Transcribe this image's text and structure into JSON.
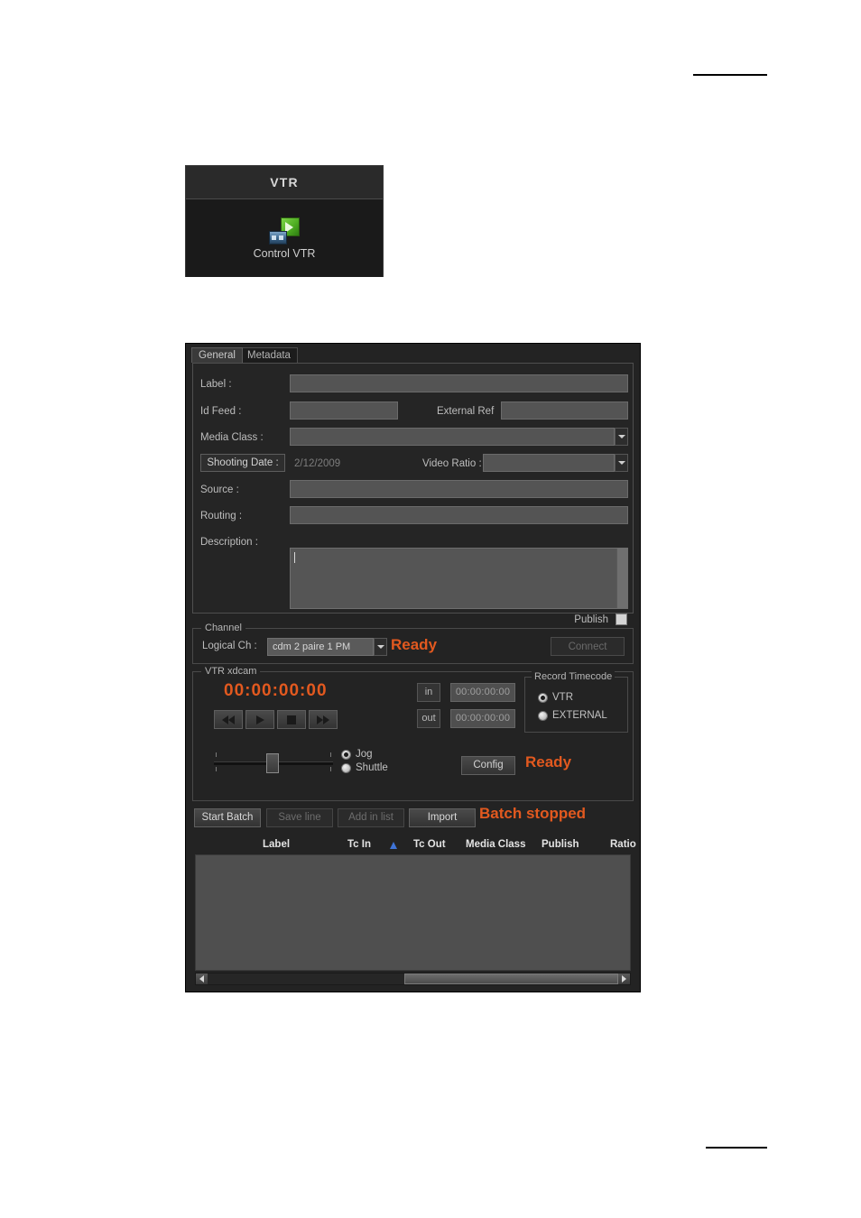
{
  "launcher": {
    "title": "VTR",
    "icon": "control-vtr-icon",
    "label": "Control VTR"
  },
  "dialog": {
    "tabs": [
      {
        "label": "General",
        "active": true
      },
      {
        "label": "Metadata",
        "active": false
      }
    ],
    "general": {
      "fields": [
        {
          "label": "Label :",
          "value": ""
        },
        {
          "label": "Id Feed :",
          "value": ""
        },
        {
          "label": "External Ref",
          "value": ""
        },
        {
          "label": "Media Class :",
          "value": ""
        },
        {
          "label": "Shooting Date :",
          "value": "2/12/2009"
        },
        {
          "label": "Video Ratio :",
          "value": ""
        },
        {
          "label": "Source :",
          "value": ""
        },
        {
          "label": "Routing :",
          "value": ""
        },
        {
          "label": "Description :",
          "value": ""
        }
      ],
      "publish": {
        "label": "Publish",
        "checked": false
      }
    },
    "channel": {
      "group_title": "Channel",
      "logical_label": "Logical Ch :",
      "logical_value": "cdm 2 paire 1 PM",
      "status": "Ready",
      "connect_label": "Connect",
      "connect_enabled": false
    },
    "vtr": {
      "group_title": "VTR xdcam",
      "timecode": "00:00:00:00",
      "transport": [
        {
          "name": "rewind-button",
          "glyph": "double-left"
        },
        {
          "name": "play-button",
          "glyph": "triangle-right"
        },
        {
          "name": "stop-button",
          "glyph": "square"
        },
        {
          "name": "forward-button",
          "glyph": "double-right"
        }
      ],
      "mode": [
        {
          "label": "Jog",
          "selected": true
        },
        {
          "label": "Shuttle",
          "selected": false
        }
      ],
      "in_label": "in",
      "in_value": "00:00:00:00",
      "out_label": "out",
      "out_value": "00:00:00:00",
      "record_timecode": {
        "group_title": "Record Timecode",
        "options": [
          {
            "label": "VTR",
            "selected": true
          },
          {
            "label": "EXTERNAL",
            "selected": false
          }
        ]
      },
      "config_label": "Config",
      "status": "Ready"
    },
    "batch": {
      "buttons": [
        {
          "label": "Start Batch",
          "enabled": true
        },
        {
          "label": "Save line",
          "enabled": false
        },
        {
          "label": "Add in list",
          "enabled": false
        },
        {
          "label": "Import",
          "enabled": true
        }
      ],
      "status": "Batch stopped"
    },
    "table": {
      "columns": [
        {
          "label": "Label",
          "sorted": false
        },
        {
          "label": "Tc In",
          "sorted": true,
          "direction": "asc"
        },
        {
          "label": "Tc Out",
          "sorted": false
        },
        {
          "label": "Media Class",
          "sorted": false
        },
        {
          "label": "Publish",
          "sorted": false
        },
        {
          "label": "Ratio",
          "sorted": false
        }
      ],
      "rows": []
    }
  },
  "colors": {
    "accent_orange": "#e2591f",
    "sort_blue": "#3f74d8",
    "panel_bg": "#232323",
    "input_bg": "#545454"
  }
}
